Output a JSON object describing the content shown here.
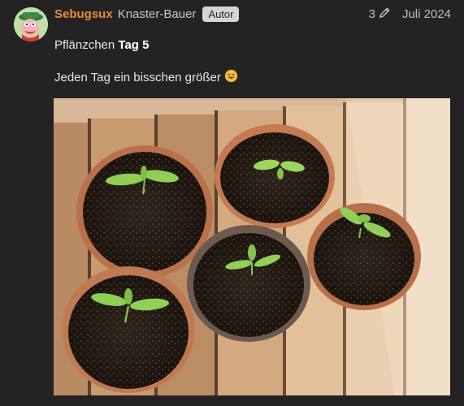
{
  "post": {
    "username": "Sebugsux",
    "full_name": "Knaster-Bauer",
    "role_badge": "Autor",
    "edit_count": "3",
    "date": "Juli 2024",
    "text_line1_prefix": "Pflänzchen ",
    "text_line1_bold": "Tag 5",
    "text_line2": "Jeden Tag ein bisschen größer",
    "emoji": "😊"
  },
  "icons": {
    "edit": "pencil-icon",
    "avatar": "avatar-image"
  },
  "colors": {
    "background": "#232323",
    "username": "#e88d3a",
    "badge_bg": "#d5d5d5",
    "muted_text": "#bdbdbd"
  }
}
